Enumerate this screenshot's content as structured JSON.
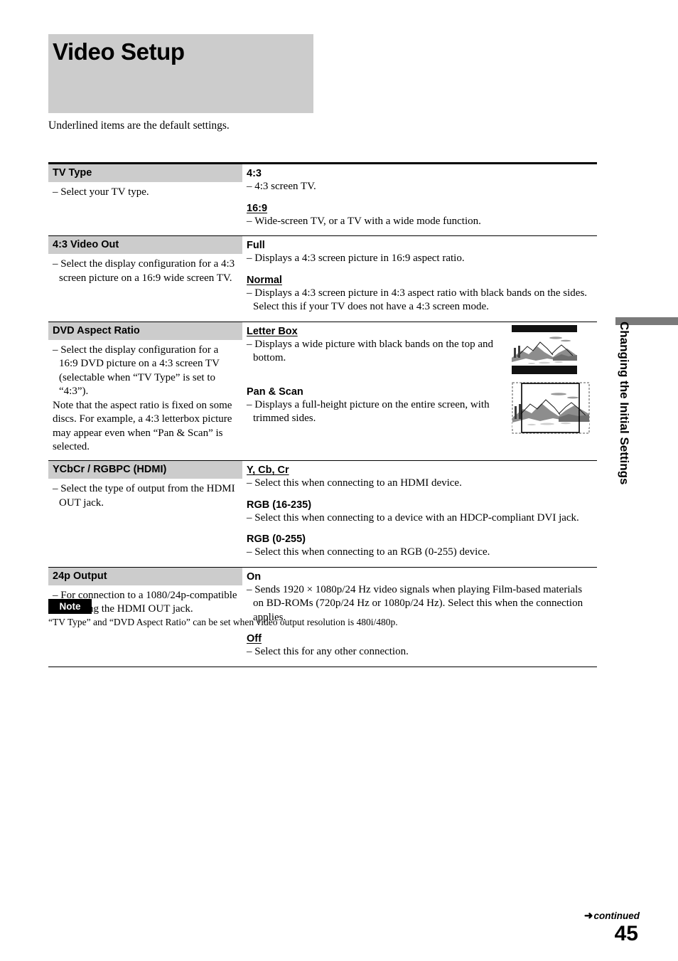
{
  "page": {
    "title": "Video Setup",
    "subtitle": "Underlined items are the default settings.",
    "page_number": "45",
    "continued_label": "continued",
    "continued_arrow": "➜",
    "side_tab_label": "Changing the Initial Settings",
    "side_tab_color": "#7a7a7a",
    "header_band_color": "#cccccc"
  },
  "table": {
    "rows": [
      {
        "name": "TV Type",
        "description": "Select your TV type.",
        "options": [
          {
            "label": "4:3",
            "underlined": false,
            "description": "4:3 screen TV."
          },
          {
            "label": "16:9",
            "underlined": true,
            "description": "Wide-screen TV, or a TV with a wide mode function."
          }
        ]
      },
      {
        "name": "4:3 Video Out",
        "description": "Select the display configuration for a 4:3 screen picture on a 16:9 wide screen TV.",
        "options": [
          {
            "label": "Full",
            "underlined": false,
            "description": "Displays a 4:3 screen picture in 16:9 aspect ratio."
          },
          {
            "label": "Normal",
            "underlined": true,
            "description": "Displays a 4:3 screen picture in 4:3 aspect ratio with black bands on the sides. Select this if your TV does not have a 4:3 screen mode."
          }
        ]
      },
      {
        "name": "DVD Aspect Ratio",
        "description": "Select the display configuration for a 16:9 DVD picture on a 4:3 screen TV (selectable when “TV Type” is set to “4:3”).",
        "description2": "Note that the aspect ratio is fixed on some discs. For example, a 4:3 letterbox picture may appear even when “Pan & Scan” is selected.",
        "options": [
          {
            "label": "Letter Box",
            "underlined": true,
            "description": "Displays a wide picture with black bands on the top and bottom.",
            "illustration": "letterbox-illustration"
          },
          {
            "label": "Pan & Scan",
            "underlined": false,
            "description": "Displays a full-height picture on the entire screen, with trimmed sides.",
            "illustration": "panscan-illustration"
          }
        ]
      },
      {
        "name": "YCbCr / RGBPC (HDMI)",
        "description": "Select the type of output from the HDMI OUT jack.",
        "options": [
          {
            "label": "Y, Cb, Cr",
            "underlined": true,
            "description": "Select this when connecting to an HDMI device."
          },
          {
            "label": "RGB (16-235)",
            "underlined": false,
            "description": "Select this when connecting to a device with an HDCP-compliant DVI jack."
          },
          {
            "label": "RGB (0-255)",
            "underlined": false,
            "description": "Select this when connecting to an RGB (0-255) device."
          }
        ]
      },
      {
        "name": "24p Output",
        "description": "For connection to a 1080/24p-compatible TV using the HDMI OUT jack.",
        "options": [
          {
            "label": "On",
            "underlined": false,
            "description": "Sends 1920 × 1080p/24 Hz video signals when playing Film-based materials on BD-ROMs (720p/24 Hz or 1080p/24 Hz). Select this when the connection applies."
          },
          {
            "label": "Off",
            "underlined": true,
            "description": "Select this for any other connection."
          }
        ]
      }
    ]
  },
  "note": {
    "badge": "Note",
    "text": "“TV Type” and “DVD Aspect Ratio” can be set when video output resolution is 480i/480p."
  }
}
